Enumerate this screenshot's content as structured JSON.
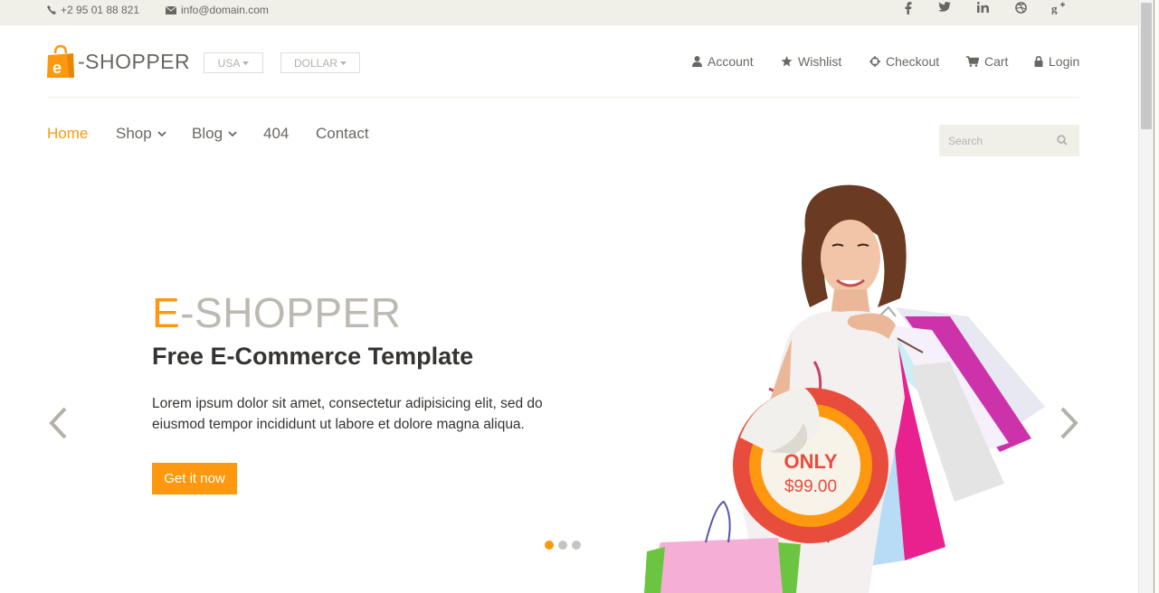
{
  "topbar": {
    "phone": "+2 95 01 88 821",
    "email": "info@domain.com",
    "social": [
      "f",
      "t",
      "in",
      "dribbble",
      "g+"
    ]
  },
  "header": {
    "logo_accent": "e",
    "logo_text": "-SHOPPER",
    "country": "USA",
    "currency": "DOLLAR",
    "menu": {
      "account": "Account",
      "wishlist": "Wishlist",
      "checkout": "Checkout",
      "cart": "Cart",
      "login": "Login"
    }
  },
  "nav": {
    "home": "Home",
    "shop": "Shop",
    "blog": "Blog",
    "page404": "404",
    "contact": "Contact"
  },
  "search": {
    "placeholder": "Search"
  },
  "hero": {
    "title_accent": "E",
    "title_rest": "-SHOPPER",
    "subtitle": "Free E-Commerce Template",
    "description": "Lorem ipsum dolor sit amet, consectetur adipisicing elit, sed do eiusmod tempor incididunt ut labore et dolore magna aliqua.",
    "button": "Get it now",
    "badge_line1": "ONLY",
    "badge_line2": "$99.00"
  },
  "colors": {
    "accent": "#FE980F",
    "text": "#696763",
    "dark": "#363432",
    "topbar_bg": "#f0f0e9"
  },
  "slider": {
    "active_slide": 1,
    "total_slides": 3
  }
}
